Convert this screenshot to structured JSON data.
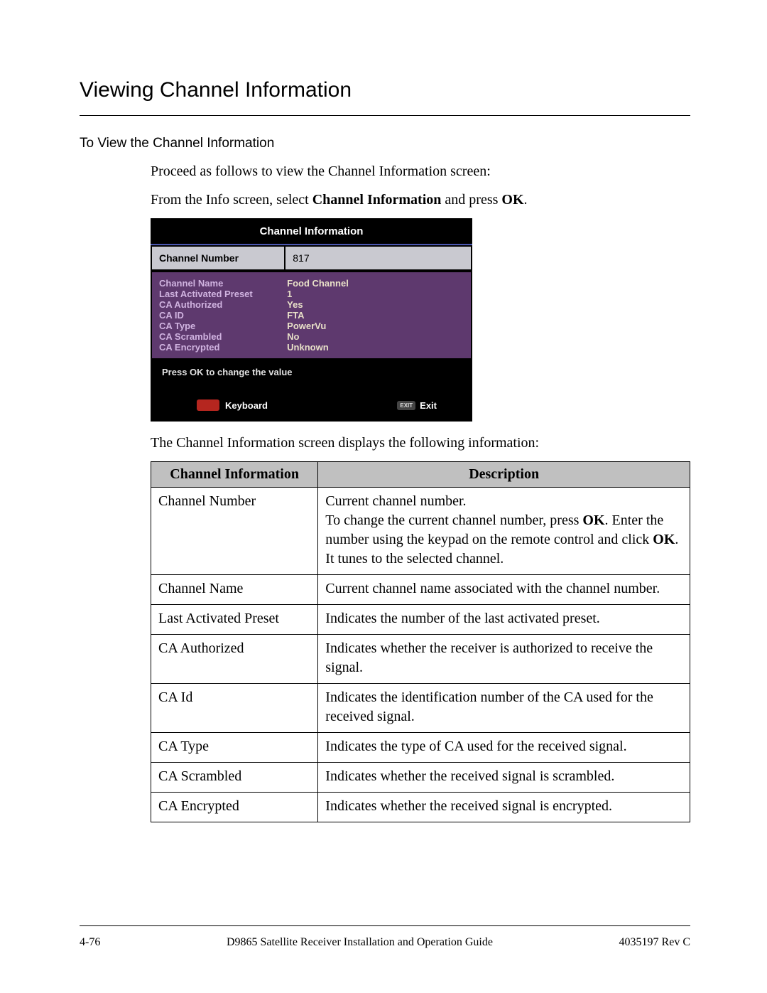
{
  "page": {
    "title": "Viewing Channel Information",
    "subhead": "To View the Channel Information",
    "intro1_a": "Proceed as follows to view the Channel Information screen:",
    "intro2_a": "From the Info screen, select ",
    "intro2_b": "Channel Information",
    "intro2_c": " and press ",
    "intro2_d": "OK",
    "intro2_e": ".",
    "after_ui": "The Channel Information screen displays the following information:"
  },
  "ui": {
    "title": "Channel Information",
    "row_label": "Channel Number",
    "row_value": "817",
    "fields": [
      {
        "k": "Channel Name",
        "v": "Food Channel"
      },
      {
        "k": "Last Activated Preset",
        "v": "1"
      },
      {
        "k": "CA Authorized",
        "v": "Yes"
      },
      {
        "k": "CA ID",
        "v": "FTA"
      },
      {
        "k": "CA Type",
        "v": "PowerVu"
      },
      {
        "k": "CA Scrambled",
        "v": "No"
      },
      {
        "k": "CA Encrypted",
        "v": "Unknown"
      }
    ],
    "hint": "Press OK to change the value",
    "keyboard_label": "Keyboard",
    "exit_badge": "EXIT",
    "exit_label": "Exit"
  },
  "table": {
    "head_a": "Channel Information",
    "head_b": "Description",
    "rows": [
      {
        "a": "Channel Number",
        "b_line1": "Current channel number.",
        "b_line2_a": "To change the current channel number, press ",
        "b_line2_b": "OK",
        "b_line2_c": ". Enter the number using the keypad on the remote control and click ",
        "b_line2_d": "OK",
        "b_line2_e": ". It tunes to the selected channel."
      },
      {
        "a": "Channel Name",
        "b": "Current channel name associated with the channel number."
      },
      {
        "a": "Last Activated Preset",
        "b": "Indicates the number of the last activated preset."
      },
      {
        "a": "CA Authorized",
        "b": "Indicates whether the receiver is authorized to receive the signal."
      },
      {
        "a": "CA Id",
        "b": "Indicates the identification number of the CA used for the received signal."
      },
      {
        "a": "CA Type",
        "b": "Indicates the type of CA used for the received signal."
      },
      {
        "a": "CA Scrambled",
        "b": "Indicates whether the received signal is scrambled."
      },
      {
        "a": "CA Encrypted",
        "b": "Indicates whether the received signal is encrypted."
      }
    ]
  },
  "footer": {
    "left": "4-76",
    "center": "D9865 Satellite Receiver Installation and Operation Guide",
    "right": "4035197 Rev C"
  }
}
